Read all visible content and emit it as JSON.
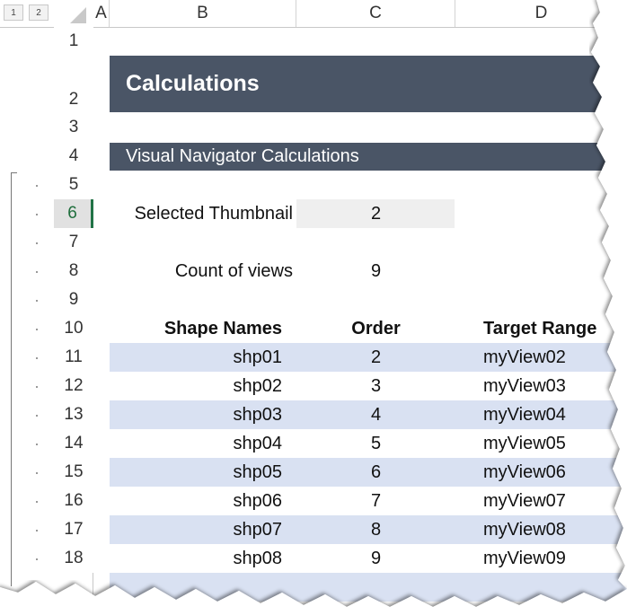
{
  "outline_levels": [
    "1",
    "2"
  ],
  "columns": [
    "A",
    "B",
    "C",
    "D"
  ],
  "rows": [
    "1",
    "2",
    "3",
    "4",
    "5",
    "6",
    "7",
    "8",
    "9",
    "10",
    "11",
    "12",
    "13",
    "14",
    "15",
    "16",
    "17",
    "18"
  ],
  "selected_row": "6",
  "title": "Calculations",
  "subtitle": "Visual Navigator Calculations",
  "selected_thumbnail": {
    "label": "Selected Thumbnail",
    "value": "2"
  },
  "count_of_views": {
    "label": "Count of views",
    "value": "9"
  },
  "table": {
    "headers": [
      "Shape Names",
      "Order",
      "Target Range"
    ],
    "rows": [
      [
        "shp01",
        "2",
        "myView02"
      ],
      [
        "shp02",
        "3",
        "myView03"
      ],
      [
        "shp03",
        "4",
        "myView04"
      ],
      [
        "shp04",
        "5",
        "myView05"
      ],
      [
        "shp05",
        "6",
        "myView06"
      ],
      [
        "shp06",
        "7",
        "myView07"
      ],
      [
        "shp07",
        "8",
        "myView08"
      ],
      [
        "shp08",
        "9",
        "myView09"
      ]
    ]
  },
  "colors": {
    "banner": "#4a5566",
    "band": "#d9e1f2",
    "selected_row_accent": "#217346"
  }
}
